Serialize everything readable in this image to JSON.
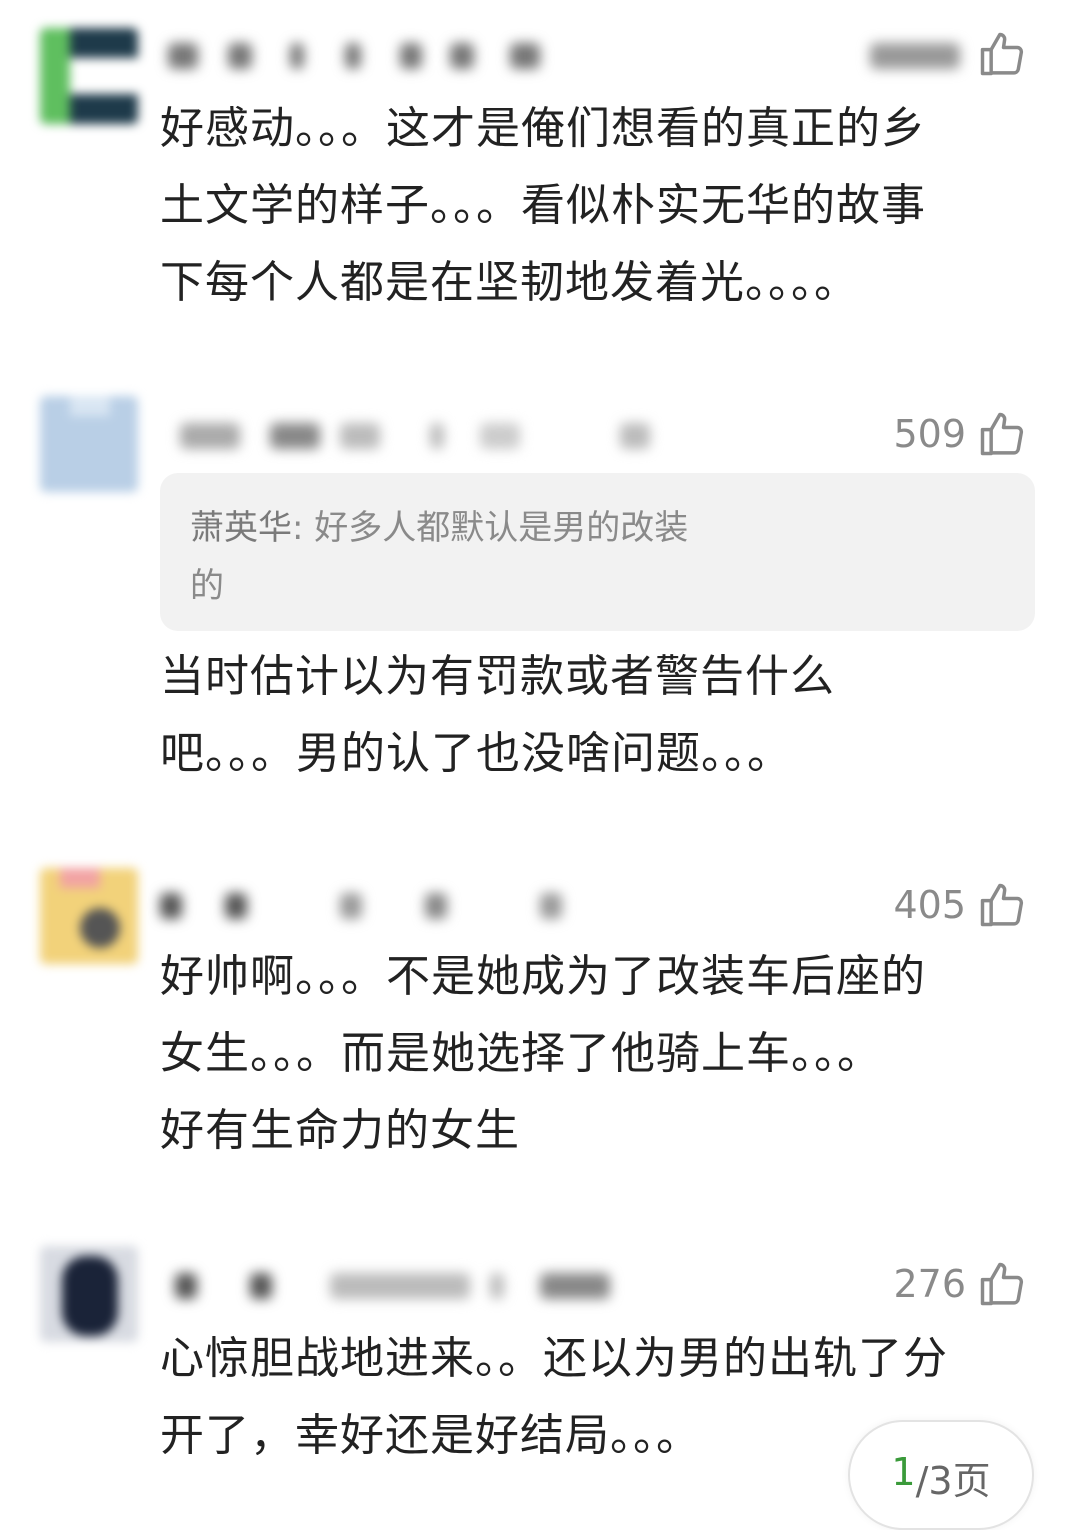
{
  "comments": [
    {
      "likes": "",
      "text_lines": [
        "好感动。。。这才是俺们想看的真正的乡",
        "土文学的样子。。。看似朴实无华的故事",
        "下每个人都是在坚韧地发着光。。。。"
      ]
    },
    {
      "likes": "509",
      "quote": {
        "author": "萧英华",
        "sep": ": ",
        "text_line1": "好多人都默认是男的改装",
        "text_line2": "的"
      },
      "text_lines": [
        "当时估计以为有罚款或者警告什么",
        "吧。。。男的认了也没啥问题。。。"
      ]
    },
    {
      "likes": "405",
      "text_lines": [
        "好帅啊。。。不是她成为了改装车后座的",
        "女生。。。而是她选择了他骑上车。。。",
        "好有生命力的女生"
      ]
    },
    {
      "likes": "276",
      "text_lines": [
        "心惊胆战地进来。。还以为男的出轨了分",
        "开了，幸好还是好结局。。。"
      ]
    }
  ],
  "pager": {
    "current": "1",
    "rest": "/3页"
  },
  "colors": {
    "page_green": "#3a9a3a",
    "meta_gray": "#8a8a8a"
  }
}
